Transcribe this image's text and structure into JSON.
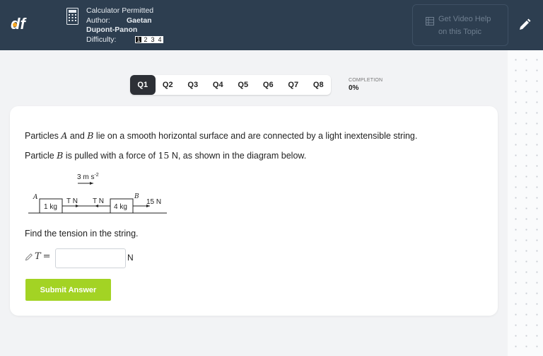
{
  "header": {
    "calculator_label": "Calculator Permitted",
    "author_key": "Author:",
    "author_name": "Gaetan",
    "author_surname": "Dupont-Panon",
    "difficulty_key": "Difficulty:",
    "difficulty_levels": [
      "1",
      "2",
      "3",
      "4"
    ],
    "difficulty_selected": 1,
    "video_help_line1": "Get Video Help",
    "video_help_line2": "on this Topic",
    "icons": {
      "logo": "df-logo",
      "calculator": "calculator-icon",
      "video": "video-icon",
      "pencil": "pencil-icon"
    }
  },
  "tabs": [
    "Q1",
    "Q2",
    "Q3",
    "Q4",
    "Q5",
    "Q6",
    "Q7",
    "Q8"
  ],
  "active_tab": "Q1",
  "completion": {
    "label": "COMPLETION",
    "value": "0%"
  },
  "question": {
    "line1_pre": "Particles ",
    "line1_a": "A",
    "line1_mid": " and ",
    "line1_b": "B",
    "line1_post": " lie on a smooth horizontal surface and are connected by a light inextensible string.",
    "line2_pre": "Particle ",
    "line2_b": "B",
    "line2_mid": " is pulled with a force of ",
    "line2_force": "15",
    "line2_post": " N, as shown in the diagram below.",
    "find": "Find the tension in the string."
  },
  "diagram": {
    "accel_label": "3 m s",
    "accel_exp": "-2",
    "label_a": "A",
    "label_b": "B",
    "mass_a": "1 kg",
    "mass_b": "4 kg",
    "tension_left": "T N",
    "tension_right": "T N",
    "force": "15 N"
  },
  "answer": {
    "variable": "T",
    "equals": "=",
    "value": "",
    "unit": "N",
    "submit_label": "Submit Answer"
  },
  "colors": {
    "header_bg": "#2d3e50",
    "submit_bg": "#a3d324",
    "active_tab_bg": "#2d3036",
    "logo_orange": "#f5a623"
  }
}
